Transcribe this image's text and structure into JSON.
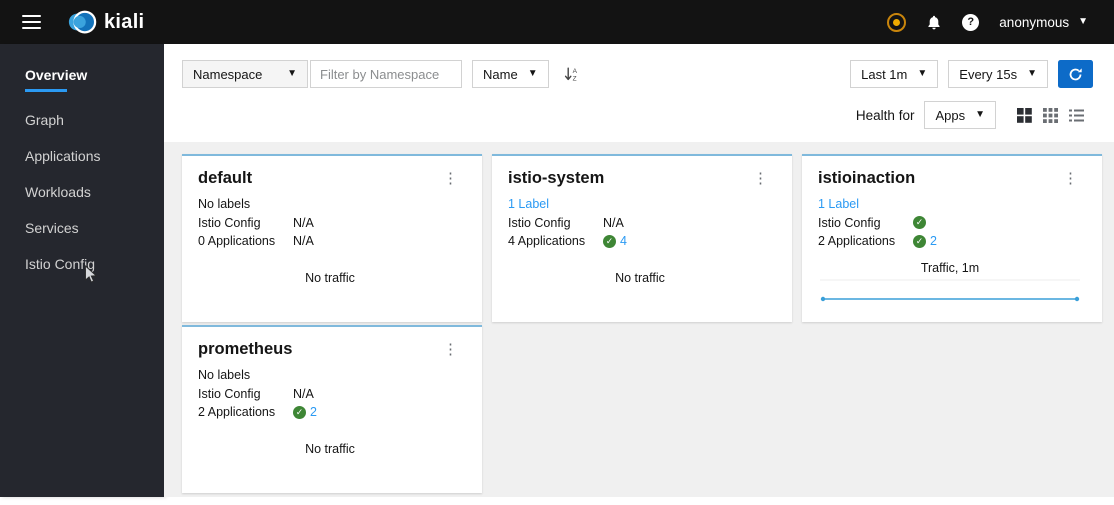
{
  "header": {
    "brand": "kiali",
    "user_menu": "anonymous"
  },
  "sidebar": {
    "items": [
      {
        "label": "Overview",
        "active": true
      },
      {
        "label": "Graph",
        "active": false
      },
      {
        "label": "Applications",
        "active": false
      },
      {
        "label": "Workloads",
        "active": false
      },
      {
        "label": "Services",
        "active": false
      },
      {
        "label": "Istio Config",
        "active": false
      }
    ]
  },
  "toolbar": {
    "namespace_filter_type": "Namespace",
    "filter_placeholder": "Filter by Namespace",
    "filter_value": "",
    "sort_by": "Name",
    "duration": "Last 1m",
    "refresh_rate": "Every 15s",
    "health_for": "Health for",
    "health_type": "Apps"
  },
  "cards": [
    {
      "title": "default",
      "labels": "No labels",
      "rows": [
        {
          "label": "Istio Config",
          "value": "N/A"
        },
        {
          "label": "0 Applications",
          "value": "N/A"
        }
      ],
      "traffic": "No traffic"
    },
    {
      "title": "istio-system",
      "labels": "1 Label",
      "rows": [
        {
          "label": "Istio Config",
          "value": "N/A"
        },
        {
          "label": "4 Applications",
          "value": "4",
          "status": "healthy"
        }
      ],
      "traffic": "No traffic"
    },
    {
      "title": "istioinaction",
      "labels": "1 Label",
      "rows": [
        {
          "label": "Istio Config",
          "value": "",
          "status": "healthy"
        },
        {
          "label": "2 Applications",
          "value": "2",
          "status": "healthy"
        }
      ],
      "chart": {
        "type": "line",
        "title": "Traffic, 1m",
        "shape": "flat line with end point markers",
        "points": [
          0,
          0
        ],
        "color": "#3a9fd9"
      }
    },
    {
      "title": "prometheus",
      "labels": "No labels",
      "rows": [
        {
          "label": "Istio Config",
          "value": "N/A"
        },
        {
          "label": "2 Applications",
          "value": "2",
          "status": "healthy"
        }
      ],
      "traffic": "No traffic"
    }
  ],
  "colors": {
    "accent_link": "#2b9af3",
    "healthy_green": "#3e8635",
    "card_top_border": "#7fb9dc",
    "refresh_button": "#0d6bc8",
    "status_dot": "#f0ab00",
    "masthead_bg": "#131313",
    "sidebar_bg": "#25272e"
  }
}
